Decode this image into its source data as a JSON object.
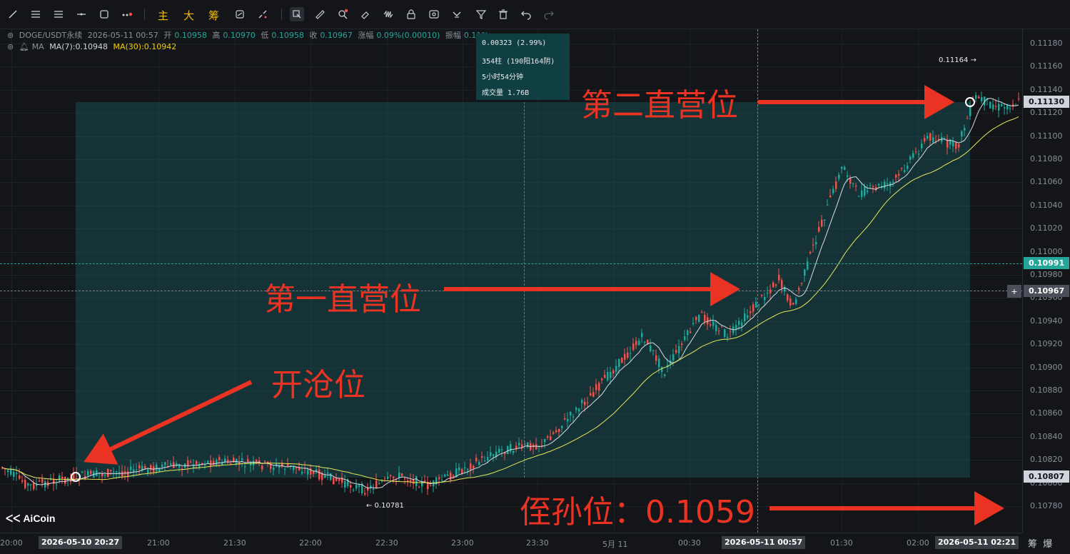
{
  "toolbar": {
    "tool_icons": [
      "trendline-icon",
      "parallel-lines-icon",
      "horizontal-lines-icon",
      "horizontal-ray-icon",
      "rectangle-icon",
      "more-shapes-icon"
    ],
    "main_label": "主",
    "big_label": "大",
    "chip_label": "筹",
    "right_icons": [
      "sync-icon",
      "brush-icon",
      "measure-select-icon",
      "ruler-icon",
      "zoom-icon",
      "eraser-icon",
      "pattern-icon",
      "lock-icon",
      "eye-icon",
      "magnet-icon",
      "filter-icon",
      "trash-icon",
      "undo-icon",
      "redo-icon"
    ]
  },
  "info": {
    "symbol": "DOGE/USDT永续",
    "datetime": "2026-05-11 00:57",
    "open_label": "开",
    "open": "0.10958",
    "high_label": "高",
    "high": "0.10970",
    "low_label": "低",
    "low": "0.10958",
    "close_label": "收",
    "close": "0.10967",
    "change_label": "涨幅",
    "change": "0.09%(0.00010)",
    "amplitude_label": "振幅",
    "amplitude": "0.11%",
    "ma_indicator": "MA",
    "ma7": "MA(7):0.10948",
    "ma30": "MA(30):0.10942"
  },
  "tooltip": {
    "line1": "0.00323 (2.99%)",
    "line2": "354柱 (190阳164阴)",
    "line3": "5小时54分钟",
    "line4": "成交量 1.76B"
  },
  "annotations": {
    "second_level": "第二直营位",
    "first_level": "第一直营位",
    "open_level": "开沧位",
    "stop_level": "侄孙位：0.1059",
    "high_marker": "0.11164 →",
    "low_marker": "← 0.10781"
  },
  "price_axis": {
    "labels": [
      "0.11180",
      "0.11160",
      "0.11140",
      "0.11120",
      "0.11100",
      "0.11080",
      "0.11060",
      "0.11040",
      "0.11020",
      "0.11000",
      "0.10980",
      "0.10960",
      "0.10940",
      "0.10920",
      "0.10900",
      "0.10880",
      "0.10860",
      "0.10840",
      "0.10820",
      "0.10800",
      "0.10780"
    ],
    "tag_top": "0.11130",
    "tag_green": "0.10991",
    "tag_current": "0.10967",
    "tag_bottom": "0.10807",
    "plus": "+"
  },
  "time_axis": {
    "start_tag": "2026-05-10 20:27",
    "labels": [
      "20:00",
      "21:00",
      "21:30",
      "22:00",
      "22:30",
      "23:00",
      "23:30",
      "5月 11",
      "00:30",
      "01:30",
      "02:00"
    ],
    "mid_tag": "2026-05-11 00:57",
    "end_tag": "2026-05-11 02:21"
  },
  "corner": {
    "chip": "筹",
    "burst": "爆"
  },
  "logo": "AiCoin",
  "colors": {
    "up": "#26a69a",
    "down": "#ef5350",
    "ma7": "#d7dbe3",
    "ma30": "#e8e85a",
    "annotation": "#ea3323",
    "measure_fill": "#16585c"
  }
}
